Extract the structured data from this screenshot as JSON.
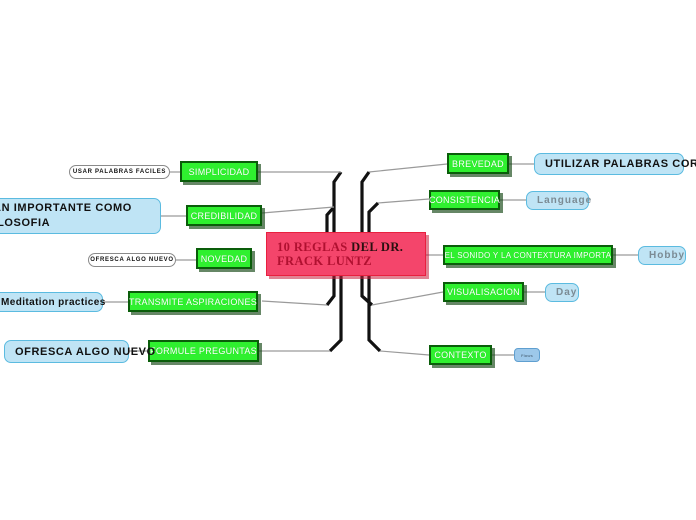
{
  "map": {
    "root": {
      "text_full": "10 REGLAS DEL DR. FRACK LUNTZ",
      "line1_a": "10 REGLAS ",
      "line1_b": "DEL DR.",
      "line2": "FRACK LUNTZ",
      "color": "#f4456b",
      "text_color": "#b01030"
    },
    "colors": {
      "branch_green": "#2ff02f",
      "branch_green_border": "#0a5d0a",
      "leaf_blue": "#bfe4f5",
      "leaf_blue_border": "#5bbbe0",
      "leaf_white": "#ffffff",
      "edge_thin": "#9a9a9a",
      "edge_thick": "#111111"
    },
    "left_branches": [
      {
        "branch": "SIMPLICIDAD",
        "leaf": "USAR PALABRAS FACILES",
        "leaf_style": "white"
      },
      {
        "branch": "CREDIBILIDAD",
        "leaf": "ES TAN IMPORTANTE COMO LA FILOSOFIA",
        "leaf_style": "blue"
      },
      {
        "branch": "NOVEDAD",
        "leaf": "OFRESCA ALGO NUEVO",
        "leaf_style": "white"
      },
      {
        "branch": "TRANSMITE ASPIRACIONES",
        "leaf": "Meditation practices",
        "leaf_style": "blue"
      },
      {
        "branch": "FORMULE PREGUNTAS",
        "leaf": "OFRESCA ALGO NUEVO",
        "leaf_style": "blue"
      }
    ],
    "right_branches": [
      {
        "branch": "BREVEDAD",
        "leaf": "UTILIZAR PALABRAS CORTAS",
        "leaf_style": "blue"
      },
      {
        "branch": "CONSISTENCIA",
        "leaf": "Language",
        "leaf_style": "blue-muted"
      },
      {
        "branch": "EL SONIDO Y LA CONTEXTURA IMPORTA",
        "leaf": "Hobby",
        "leaf_style": "blue-muted"
      },
      {
        "branch": "VISUALISACION",
        "leaf": "Day",
        "leaf_style": "blue-muted"
      },
      {
        "branch": "CONTEXTO",
        "leaf": "Flaws",
        "leaf_style": "blue-tiny"
      }
    ]
  }
}
